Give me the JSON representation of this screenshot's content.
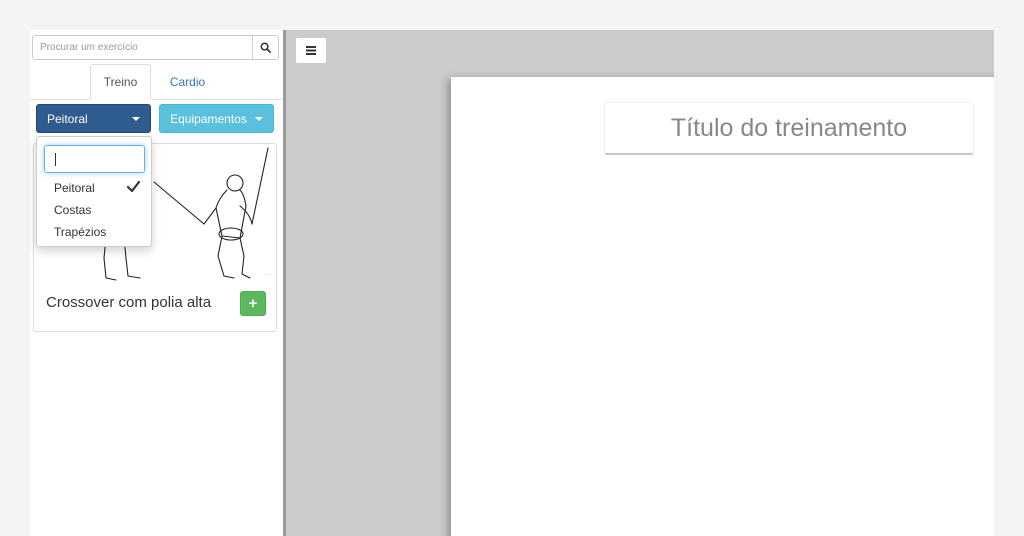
{
  "search": {
    "placeholder": "Procurar um exercício",
    "icon": "search-icon"
  },
  "tabs": [
    {
      "label": "Treino",
      "active": true
    },
    {
      "label": "Cardio",
      "active": false
    }
  ],
  "filters": {
    "muscle": {
      "label": "Peitoral",
      "color": "#2e5c8f"
    },
    "equipment": {
      "label": "Equipamentos",
      "color": "#5bc0de"
    }
  },
  "dropdown": {
    "filter_value": "",
    "options": [
      {
        "label": "Peitoral",
        "selected": true
      },
      {
        "label": "Costas",
        "selected": false
      },
      {
        "label": "Trapézios",
        "selected": false
      }
    ]
  },
  "exercise": {
    "name": "Crossover com polia alta",
    "add_label": "+",
    "add_color": "#5cb85c"
  },
  "workout": {
    "title_placeholder": "Título do treinamento"
  }
}
